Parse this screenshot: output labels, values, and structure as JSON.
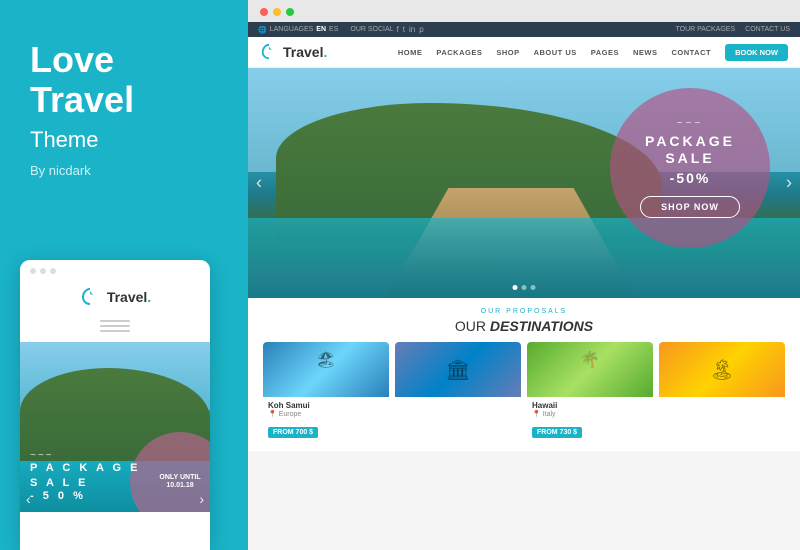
{
  "left": {
    "title": "Love\nTravel",
    "subtitle": "Theme",
    "by": "By nicdark",
    "mobile": {
      "logo_text": "Travel",
      "logo_dot": ".",
      "only_until": "ONLY UNTIL\n10.01.18",
      "wave": "~~~",
      "package": "P A C K A G E",
      "sale": "S A L E",
      "fifty": "-50%"
    }
  },
  "browser": {
    "dots": [
      "red",
      "yellow",
      "green"
    ]
  },
  "website": {
    "utility": {
      "languages": "LANGUAGES",
      "lang_en": "EN",
      "lang_es": "ES",
      "our_social": "OUR SOCIAL",
      "tour_packages": "TOUR PACKAGES",
      "contact": "CONTACT US"
    },
    "nav": {
      "logo_text": "Travel",
      "logo_dot": ".",
      "links": [
        "HOME",
        "PACKAGES",
        "SHOP",
        "ABOUT US",
        "PAGES",
        "NEWS",
        "CONTACT"
      ],
      "book_btn": "BOOK NOW"
    },
    "hero": {
      "wave": "~~~",
      "package": "PACKAGE",
      "sale": "SALE",
      "discount": "-50%",
      "shop_btn": "SHOP NOW"
    },
    "destinations": {
      "label": "OUR PROPOSALS",
      "title_plain": "OUR",
      "title_bold": "DESTINATIONS",
      "cards": [
        {
          "name": "Koh Samui",
          "region": "Europe",
          "price": "FROM 700 $",
          "img_type": "koh"
        },
        {
          "name": "",
          "region": "",
          "price": "",
          "img_type": "europe"
        },
        {
          "name": "Hawaii",
          "region": "Italy",
          "price": "FROM 730 $",
          "img_type": "hawaii"
        },
        {
          "name": "",
          "region": "",
          "price": "",
          "img_type": "italy"
        }
      ]
    }
  }
}
